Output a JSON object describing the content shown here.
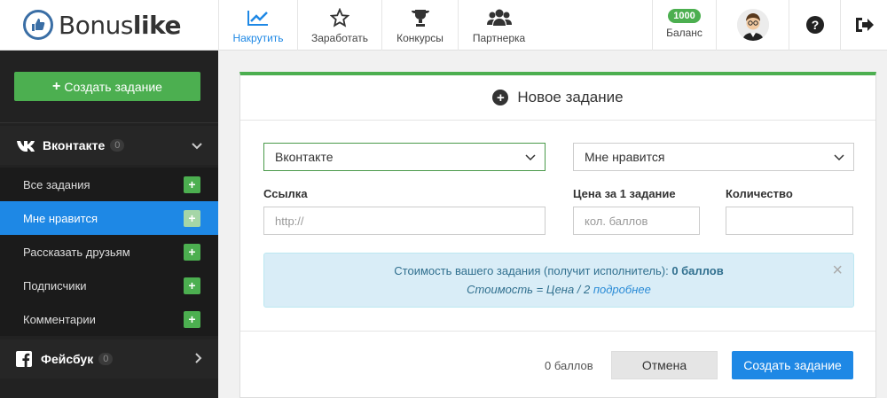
{
  "brand": {
    "name_light": "Bonus",
    "name_bold": "like"
  },
  "nav": [
    {
      "label": "Накрутить",
      "icon": "chart-line-icon",
      "active": true
    },
    {
      "label": "Заработать",
      "icon": "star-icon"
    },
    {
      "label": "Конкурсы",
      "icon": "trophy-icon"
    },
    {
      "label": "Партнерка",
      "icon": "users-icon"
    }
  ],
  "balance": {
    "amount": "1000",
    "label": "Баланс"
  },
  "sidebar": {
    "create_label": "Создать задание",
    "sections": [
      {
        "label": "Вконтакте",
        "count": "0",
        "icon": "vk-icon"
      },
      {
        "label": "Фейсбук",
        "count": "0",
        "icon": "facebook-icon"
      }
    ],
    "items": [
      {
        "label": "Все задания"
      },
      {
        "label": "Мне нравится",
        "active": true
      },
      {
        "label": "Рассказать друзьям"
      },
      {
        "label": "Подписчики"
      },
      {
        "label": "Комментарии"
      }
    ]
  },
  "form": {
    "title": "Новое задание",
    "network_value": "Вконтакте",
    "action_value": "Мне нравится",
    "link_label": "Ссылка",
    "link_placeholder": "http://",
    "price_label": "Цена за 1 задание",
    "price_placeholder": "кол. баллов",
    "qty_label": "Количество",
    "qty_placeholder": "",
    "alert": {
      "line1_prefix": "Стоимость вашего задания (получит исполнитель): ",
      "line1_value": "0 баллов",
      "line2_prefix": "Стоимость = Цена / 2 ",
      "line2_link": "подробнее"
    },
    "footer_amount": "0 баллов",
    "cancel_label": "Отмена",
    "submit_label": "Создать задание"
  },
  "colors": {
    "accent": "#1e88e5",
    "success": "#4caf50",
    "sidebar": "#222222"
  }
}
